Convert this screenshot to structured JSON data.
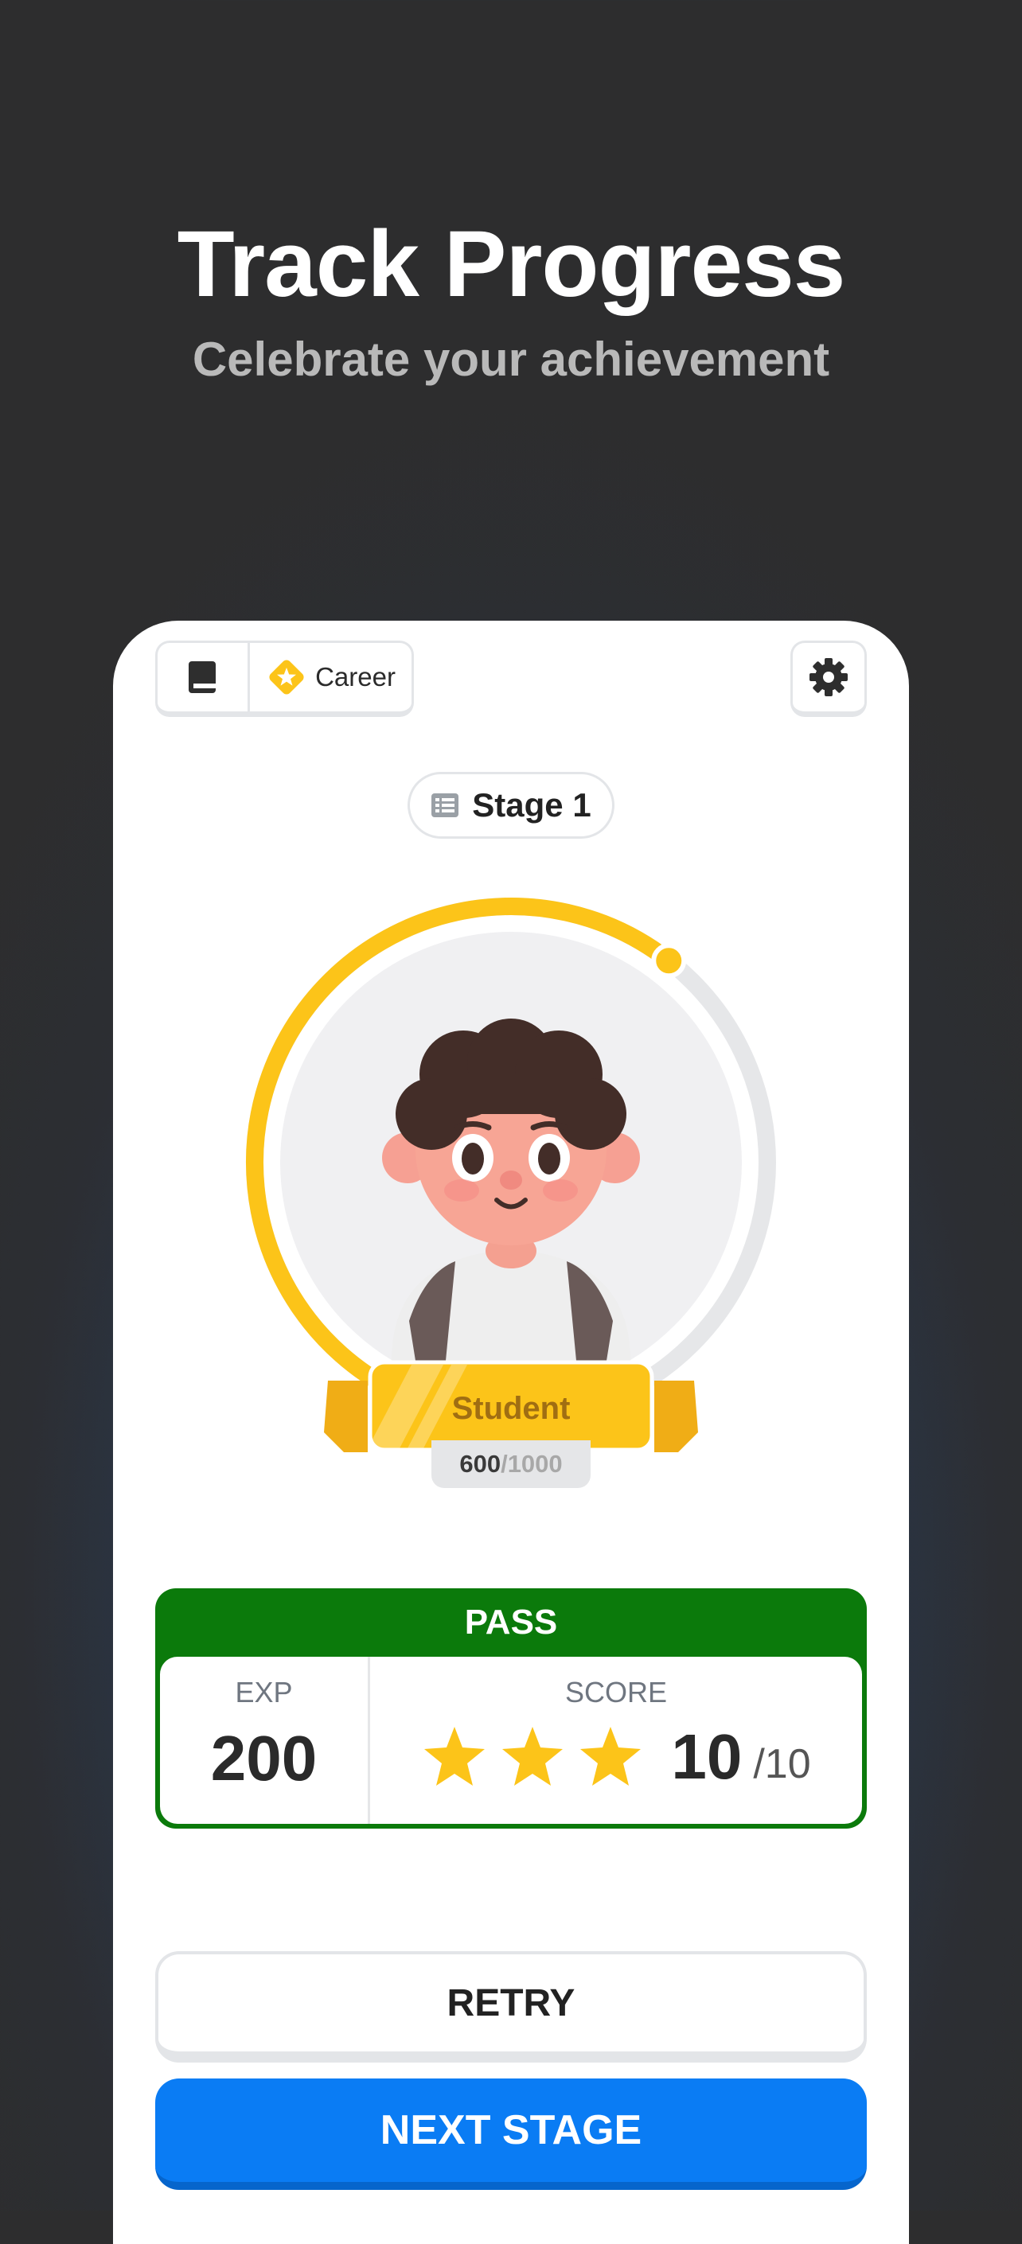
{
  "hero": {
    "title": "Track Progress",
    "subtitle": "Celebrate your achievement"
  },
  "topbar": {
    "career_label": "Career",
    "book_icon": "book-icon",
    "career_icon": "star-diamond-icon",
    "settings_icon": "gear-icon"
  },
  "stage": {
    "label": "Stage 1",
    "icon": "list-icon"
  },
  "avatar": {
    "rank_title": "Student",
    "exp_current": "600",
    "exp_max": "/1000",
    "progress_fraction": 0.6
  },
  "result": {
    "status": "PASS",
    "exp_label": "EXP",
    "exp_value": "200",
    "score_label": "SCORE",
    "score_value": "10",
    "score_max": "/10",
    "stars_filled": 3,
    "stars_total": 3
  },
  "buttons": {
    "retry": "RETRY",
    "next_stage": "NEXT STAGE"
  },
  "colors": {
    "accent_yellow": "#fcc419",
    "pass_green": "#0b7a0b",
    "primary_blue": "#0a7cf4"
  }
}
